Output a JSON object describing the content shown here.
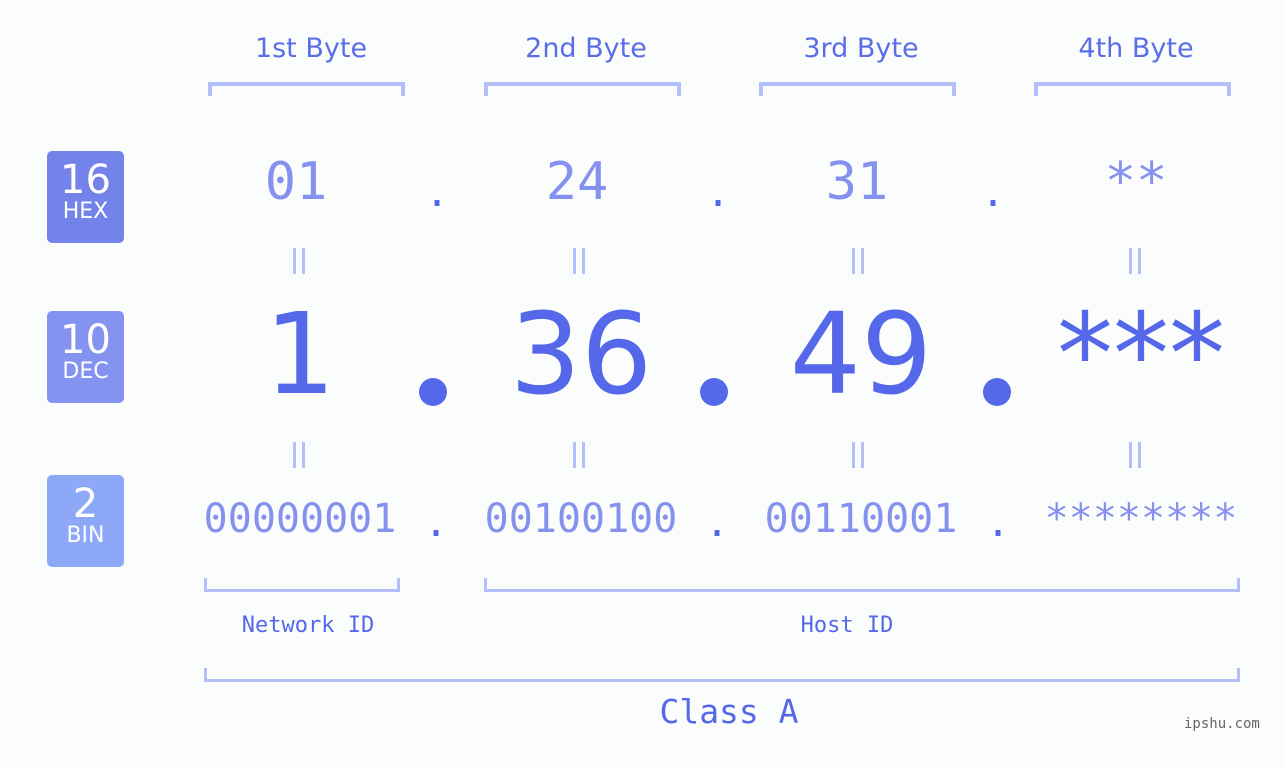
{
  "byte_headers": [
    "1st Byte",
    "2nd Byte",
    "3rd Byte",
    "4th Byte"
  ],
  "badges": [
    {
      "num": "16",
      "label": "HEX",
      "color": "#7483ea"
    },
    {
      "num": "10",
      "label": "DEC",
      "color": "#8493f0"
    },
    {
      "num": "2",
      "label": "BIN",
      "color": "#8ea8f8"
    }
  ],
  "hex_values": [
    "01",
    "24",
    "31",
    "**"
  ],
  "dec_values": [
    "1",
    "36",
    "49",
    "***"
  ],
  "bin_values": [
    "00000001",
    "00100100",
    "00110001",
    "********"
  ],
  "separator": ".",
  "network_label": "Network ID",
  "host_label": "Host ID",
  "class_label": "Class A",
  "watermark": "ipshu.com",
  "colors": {
    "accent": "#5468e9",
    "light": "#8591ee",
    "bracket": "#b3bff8"
  }
}
